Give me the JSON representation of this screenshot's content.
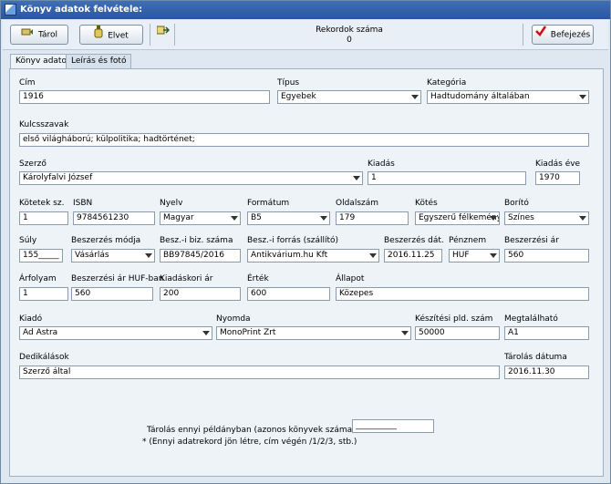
{
  "window": {
    "title": "Könyv adatok felvétele:"
  },
  "toolbar": {
    "save_label": "Tárol",
    "discard_label": "Elvet",
    "close_label": "Befejezés",
    "record_count_label": "Rekordok száma",
    "record_count_value": "0"
  },
  "tabs": [
    {
      "label": "Könyv adatok"
    },
    {
      "label": "Leírás és fotó"
    }
  ],
  "fields": {
    "cim": {
      "label": "Cím",
      "value": "1916"
    },
    "tipus": {
      "label": "Típus",
      "value": "Egyebek"
    },
    "kategoria": {
      "label": "Kategória",
      "value": "Hadtudomány általában"
    },
    "kulcsszavak": {
      "label": "Kulcsszavak",
      "value": "első világháború; külpolitika; hadtörténet;"
    },
    "szerzo": {
      "label": "Szerző",
      "value": "Károlyfalvi József"
    },
    "kiadas": {
      "label": "Kiadás",
      "value": "1"
    },
    "kiadas_eve": {
      "label": "Kiadás éve",
      "value": "1970"
    },
    "kotetek": {
      "label": "Kötetek sz.",
      "value": "1"
    },
    "isbn": {
      "label": "ISBN",
      "value": "9784561230"
    },
    "nyelv": {
      "label": "Nyelv",
      "value": "Magyar"
    },
    "formatum": {
      "label": "Formátum",
      "value": "B5"
    },
    "oldalszam": {
      "label": "Oldalszám",
      "value": "179"
    },
    "kotes": {
      "label": "Kötés",
      "value": "Egyszerű félkemény"
    },
    "borito": {
      "label": "Borító",
      "value": "Színes"
    },
    "suly": {
      "label": "Súly",
      "value": "155_____"
    },
    "beszerzes_modja": {
      "label": "Beszerzés módja",
      "value": "Vásárlás"
    },
    "besz_biz_szama": {
      "label": "Besz.-i biz. száma",
      "value": "BB97845/2016"
    },
    "besz_forras": {
      "label": "Besz.-i forrás (szállító)",
      "value": "Antikvárium.hu Kft"
    },
    "beszerzes_dat": {
      "label": "Beszerzés dát.",
      "value": "2016.11.25"
    },
    "penznem": {
      "label": "Pénznem",
      "value": "HUF"
    },
    "beszerzesi_ar": {
      "label": "Beszerzési ár",
      "value": "560"
    },
    "arfolyam": {
      "label": "Árfolyam",
      "value": "1"
    },
    "beszerzesi_ar_huf": {
      "label": "Beszerzési ár HUF-ban",
      "value": "560"
    },
    "kiadaskori_ar": {
      "label": "Kiadáskori ár",
      "value": "200"
    },
    "ertek": {
      "label": "Érték",
      "value": "600"
    },
    "allapot": {
      "label": "Állapot",
      "value": "Közepes"
    },
    "kiado": {
      "label": "Kiadó",
      "value": "Ad Astra"
    },
    "nyomda": {
      "label": "Nyomda",
      "value": "MonoPrint Zrt"
    },
    "keszitesi_pld_szam": {
      "label": "Készítési pld. szám",
      "value": "50000"
    },
    "megtalalhato": {
      "label": "Megtalálható",
      "value": "A1"
    },
    "dedikalasok": {
      "label": "Dedikálások",
      "value": "Szerző által"
    },
    "tarolas_datuma": {
      "label": "Tárolás dátuma",
      "value": "2016.11.30"
    }
  },
  "copies": {
    "label": "Tárolás ennyi példányban (azonos könyvek száma):",
    "value": "__________",
    "note": "* (Ennyi adatrekord jön létre, cím végén  /1/2/3, stb.)"
  },
  "icons": {
    "save": "disk-arrow-icon",
    "discard": "bottle-icon",
    "export": "export-icon",
    "close": "red-check-icon"
  }
}
